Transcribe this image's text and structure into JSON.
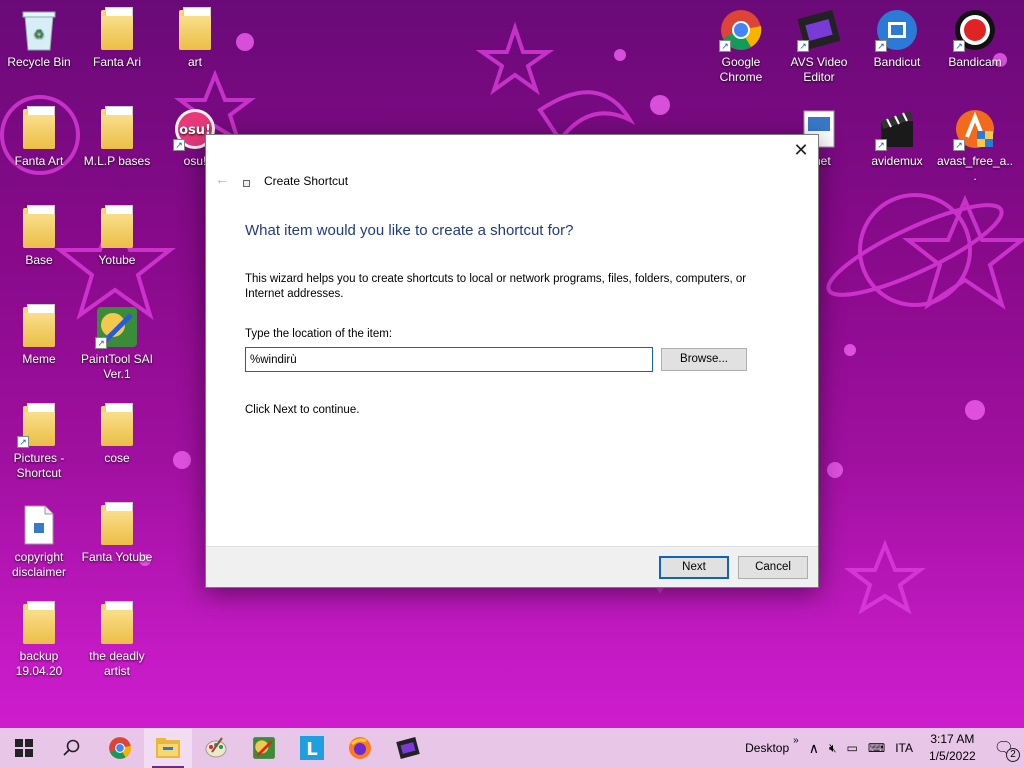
{
  "desktop": {
    "icons_left": [
      {
        "label": "Recycle Bin",
        "icon": "recycle-bin-icon"
      },
      {
        "label": "Fanta Ari",
        "icon": "folder-icon"
      },
      {
        "label": "art",
        "icon": "folder-icon"
      },
      {
        "label": "Fanta Art",
        "icon": "folder-icon"
      },
      {
        "label": "M.L.P bases",
        "icon": "folder-icon"
      },
      {
        "label": "osu!",
        "icon": "osu-icon"
      },
      {
        "label": "Base",
        "icon": "folder-icon"
      },
      {
        "label": "Yotube",
        "icon": "folder-icon"
      },
      {
        "label": "Meme",
        "icon": "folder-icon"
      },
      {
        "label": "PaintTool SAI Ver.1",
        "icon": "painttool-sai-icon"
      },
      {
        "label": "Pictures - Shortcut",
        "icon": "pictures-shortcut-icon"
      },
      {
        "label": "cose",
        "icon": "folder-icon"
      },
      {
        "label": "copyright disclaimer",
        "icon": "document-icon"
      },
      {
        "label": "Fanta Yotube",
        "icon": "folder-icon"
      },
      {
        "label": "backup 19.04.20",
        "icon": "folder-icon"
      },
      {
        "label": "the deadly artist",
        "icon": "folder-icon"
      }
    ],
    "icons_right": [
      {
        "label": "Google Chrome",
        "icon": "chrome-icon"
      },
      {
        "label": "AVS Video Editor",
        "icon": "avs-video-editor-icon"
      },
      {
        "label": "Bandicut",
        "icon": "bandicut-icon"
      },
      {
        "label": "Bandicam",
        "icon": "bandicam-icon"
      },
      {
        "label": "t.net",
        "icon": "document-icon"
      },
      {
        "label": "avidemux",
        "icon": "avidemux-icon"
      },
      {
        "label": "avast_free_a...",
        "icon": "avast-icon"
      }
    ]
  },
  "dialog": {
    "title": "Create Shortcut",
    "heading": "What item would you like to create a shortcut for?",
    "description": "This wizard helps you to create shortcuts to local or network programs, files, folders, computers, or Internet addresses.",
    "location_label": "Type the location of the item:",
    "location_value": "%windirù",
    "browse_label": "Browse...",
    "continue_text": "Click Next to continue.",
    "next_label": "Next",
    "cancel_label": "Cancel"
  },
  "taskbar": {
    "apps": [
      "start-icon",
      "search-icon",
      "chrome-icon",
      "file-explorer-icon",
      "paint-icon",
      "painttool-sai-icon",
      "l-app-icon",
      "firefox-icon",
      "video-editor-icon"
    ],
    "desktop_label": "Desktop",
    "chevron": "»",
    "language": "ITA",
    "time": "3:17 AM",
    "date": "1/5/2022",
    "notification_count": "2"
  },
  "colors": {
    "accent": "#0c64c0",
    "heading": "#1e3a8a",
    "taskbar": "#e8c6e8",
    "wallpaper_top": "#6a0a78",
    "wallpaper_bottom": "#d21ed2"
  }
}
